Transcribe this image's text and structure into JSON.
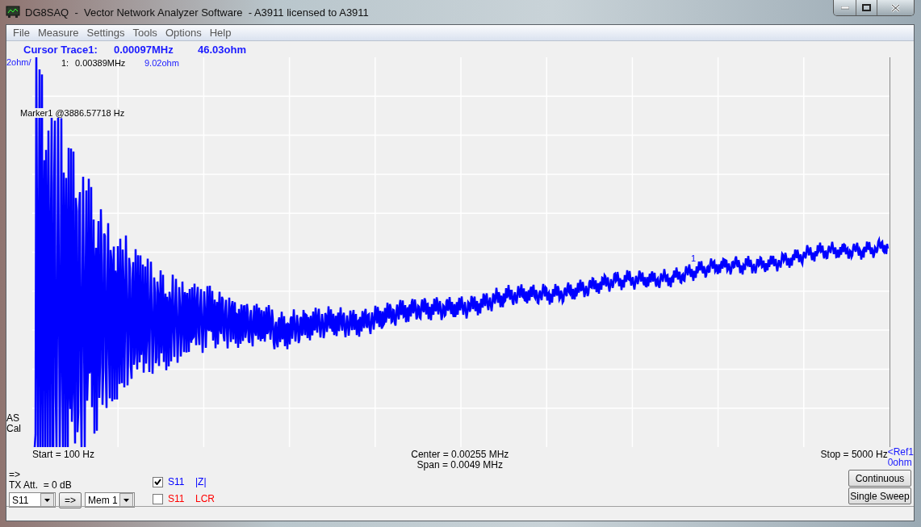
{
  "window": {
    "title": "DG8SAQ  -  Vector Network Analyzer Software  - A3911 licensed to A3911"
  },
  "menu": [
    "File",
    "Measure",
    "Settings",
    "Tools",
    "Options",
    "Help"
  ],
  "cursor": {
    "label": "Cursor Trace1:",
    "frequency": "0.00097MHz",
    "value": "46.03ohm"
  },
  "plot": {
    "scale": "2ohm/",
    "marker_index": "1:",
    "marker_frequency": "0.00389MHz",
    "marker_value": "9.02ohm",
    "marker_label": "Marker1 @3886.57718 Hz",
    "marker_flag": "1",
    "cal_status": [
      "AS",
      "Cal"
    ],
    "start": "Start = 100 Hz",
    "center": "Center = 0.00255 MHz",
    "span": "Span = 0.0049 MHz",
    "stop": "Stop = 5000 Hz",
    "ref": [
      "<Ref1",
      "0ohm"
    ]
  },
  "controls": {
    "arrow_label": "=>",
    "tx_att": "TX Att.  = 0 dB",
    "parameter": "S11",
    "copy_button": "=>",
    "memory": "Mem 1"
  },
  "traces": [
    {
      "parameter": "S11",
      "format": "|Z|",
      "checked": true,
      "color": "#0000ff"
    },
    {
      "parameter": "S11",
      "format": "LCR",
      "checked": false,
      "color": "#ff0000"
    }
  ],
  "buttons": [
    "Continuous",
    "Single Sweep"
  ]
}
